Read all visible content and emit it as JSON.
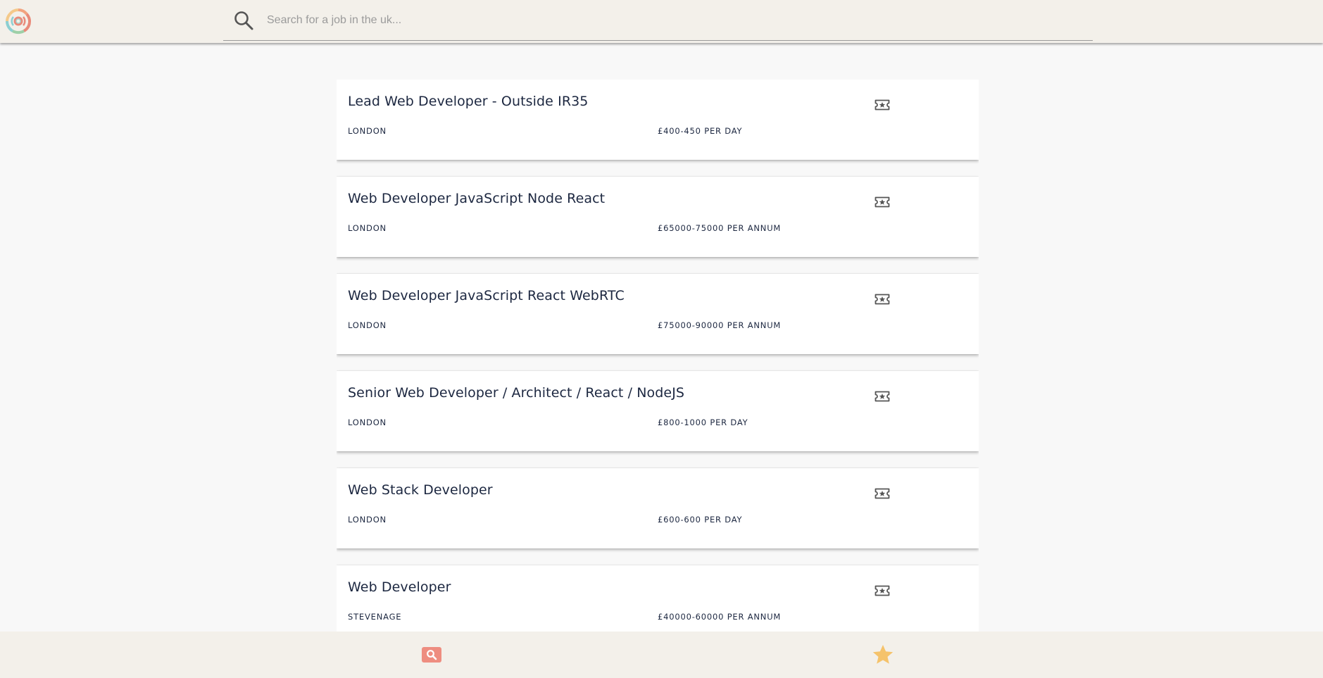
{
  "header": {
    "logo_icon": "concentric-target-logo-icon",
    "search_icon": "search-icon",
    "search_placeholder": "Search for a job in the uk...",
    "search_value": ""
  },
  "jobs": [
    {
      "title": "Lead Web Developer - Outside IR35",
      "location": "LONDON",
      "salary": "£400-450 PER DAY"
    },
    {
      "title": "Web Developer JavaScript Node React",
      "location": "LONDON",
      "salary": "£65000-75000 PER ANNUM"
    },
    {
      "title": "Web Developer JavaScript React WebRTC",
      "location": "LONDON",
      "salary": "£75000-90000 PER ANNUM"
    },
    {
      "title": "Senior Web Developer / Architect / React / NodeJS",
      "location": "LONDON",
      "salary": "£800-1000 PER DAY"
    },
    {
      "title": "Web Stack Developer",
      "location": "LONDON",
      "salary": "£600-600 PER DAY"
    },
    {
      "title": "Web Developer",
      "location": "STEVENAGE",
      "salary": "£40000-60000 PER ANNUM"
    }
  ],
  "save_icon": "ticket-star-icon",
  "bottom_nav": {
    "search_tab_icon": "search-icon",
    "favorites_tab_icon": "star-icon"
  },
  "colors": {
    "header_bg": "#f3f0ea",
    "page_bg": "#f8f8f8",
    "text": "#1c2740",
    "nav_search_accent": "#ee8d80",
    "nav_star_accent": "#f5c36b"
  }
}
